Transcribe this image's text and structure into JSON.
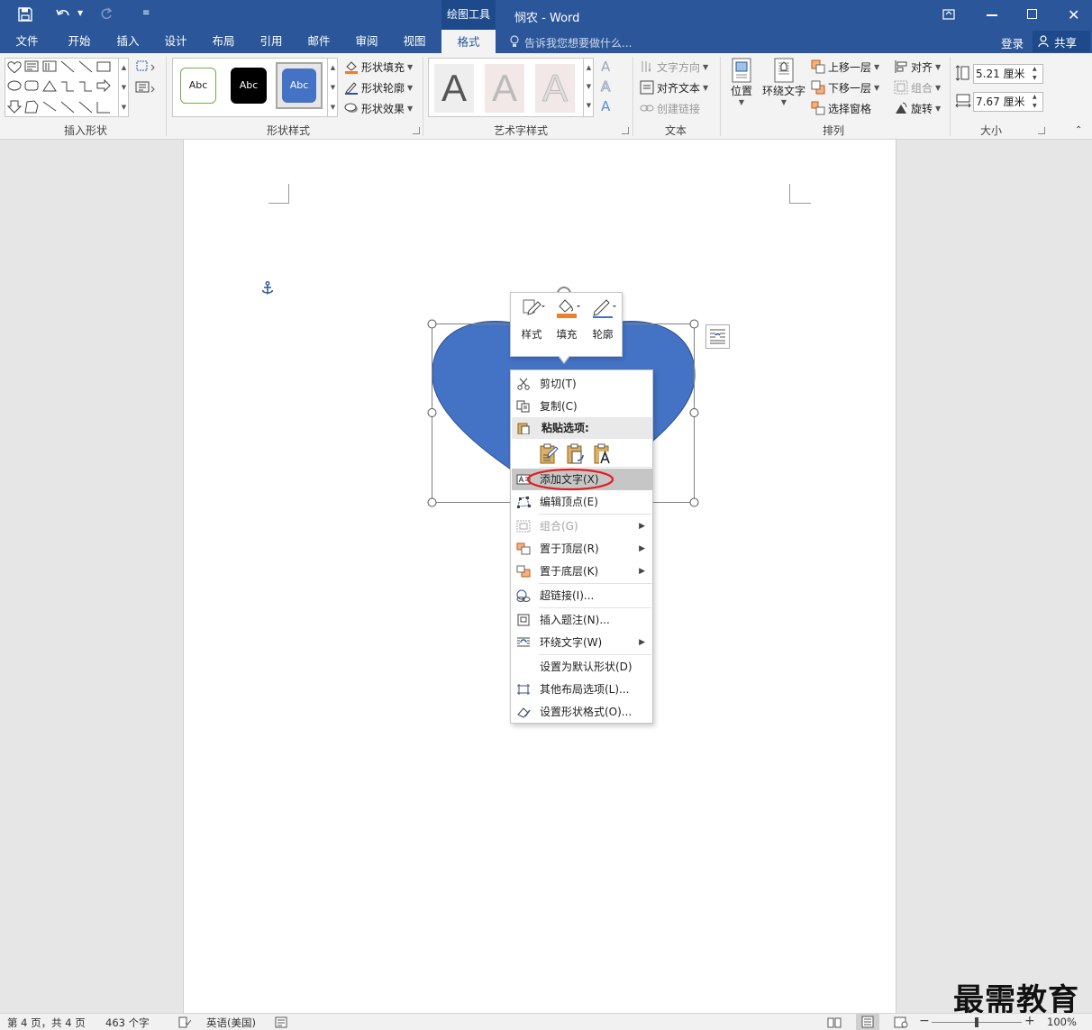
{
  "title": {
    "doc_name": "悯农",
    "separator": " - ",
    "app_name": "Word",
    "context_tab_group": "绘图工具"
  },
  "tabs": [
    "文件",
    "开始",
    "插入",
    "设计",
    "布局",
    "引用",
    "邮件",
    "审阅",
    "视图",
    "格式"
  ],
  "active_tab": "格式",
  "tellme": "告诉我您想要做什么...",
  "account": {
    "login": "登录",
    "share": "共享"
  },
  "ribbon": {
    "insert_shapes": {
      "label": "插入形状"
    },
    "shape_styles": {
      "label": "形状样式",
      "swatch_text": "Abc",
      "fill": "形状填充",
      "outline": "形状轮廓",
      "effects": "形状效果"
    },
    "wordart": {
      "label": "艺术字样式",
      "letter": "A"
    },
    "text": {
      "label": "文本",
      "direction": "文字方向",
      "align": "对齐文本",
      "link": "创建链接"
    },
    "arrange": {
      "label": "排列",
      "position": "位置",
      "wrap": "环绕文字",
      "forward": "上移一层",
      "backward": "下移一层",
      "pane": "选择窗格",
      "align": "对齐",
      "group": "组合",
      "rotate": "旋转"
    },
    "size": {
      "label": "大小",
      "height": "5.21 厘米",
      "width": "7.67 厘米"
    }
  },
  "mini_toolbar": {
    "style": "样式",
    "fill": "填充",
    "outline": "轮廓"
  },
  "context_menu": {
    "cut": "剪切(T)",
    "copy": "复制(C)",
    "paste_header": "粘贴选项:",
    "add_text": "添加文字(X)",
    "edit_points": "编辑顶点(E)",
    "group": "组合(G)",
    "bring_front": "置于顶层(R)",
    "send_back": "置于底层(K)",
    "hyperlink": "超链接(I)...",
    "caption": "插入题注(N)...",
    "wrap": "环绕文字(W)",
    "default_shape": "设置为默认形状(D)",
    "more_layout": "其他布局选项(L)...",
    "format_shape": "设置形状格式(O)..."
  },
  "status": {
    "page": "第 4 页，共 4 页",
    "words": "463 个字",
    "language": "英语(美国)",
    "zoom": "100%"
  },
  "watermark": "最需教育",
  "colors": {
    "brand": "#2b579a",
    "shape_fill": "#4472c4",
    "highlight_circle": "#e02020",
    "fill_bar": "#ed7d31"
  }
}
